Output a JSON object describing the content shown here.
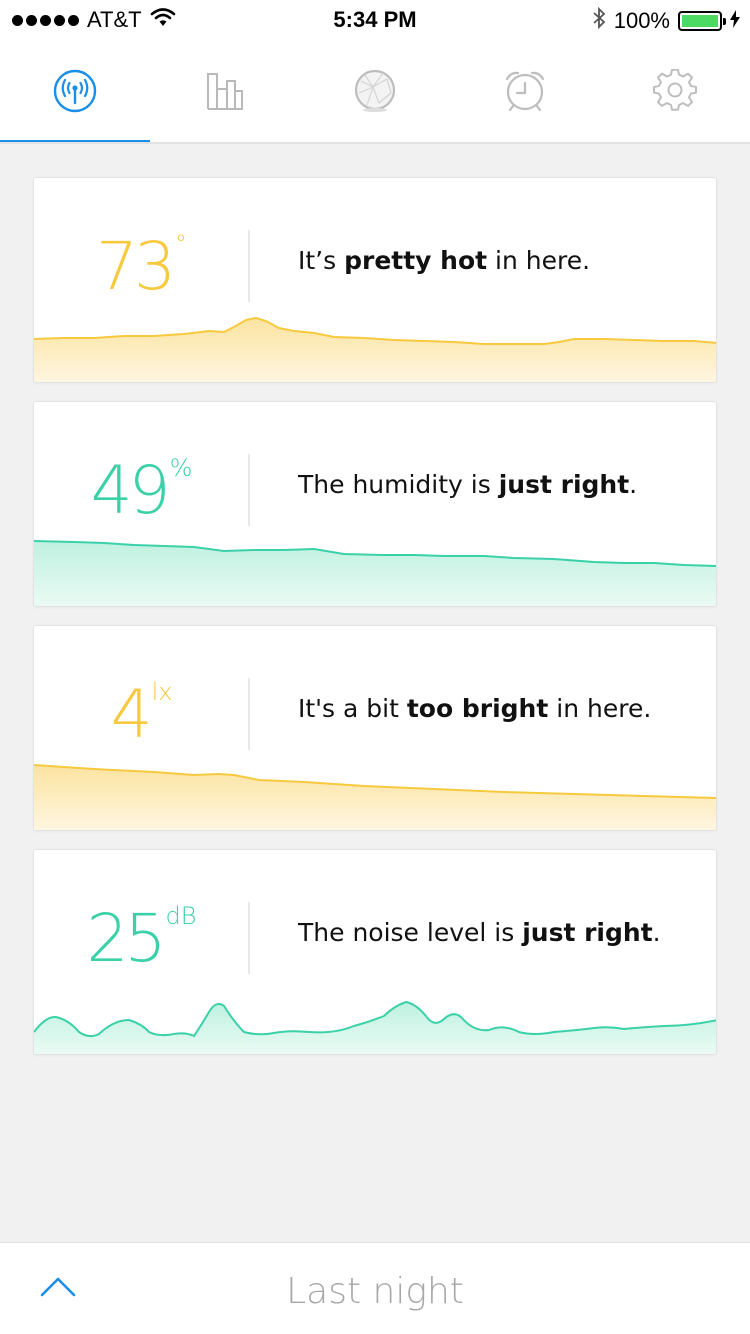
{
  "status_bar": {
    "carrier": "AT&T",
    "time": "5:34 PM",
    "battery": "100%"
  },
  "tabs": [
    {
      "icon": "broadcast-icon",
      "active": true
    },
    {
      "icon": "bar-chart-icon",
      "active": false
    },
    {
      "icon": "sleep-sphere-icon",
      "active": false
    },
    {
      "icon": "alarm-clock-icon",
      "active": false
    },
    {
      "icon": "gear-icon",
      "active": false
    }
  ],
  "cards": [
    {
      "metric": "temperature",
      "value": "73",
      "unit": "°",
      "color": "#f7c93e",
      "message": {
        "pre": "It’s ",
        "bold": "pretty hot",
        "post": " in here."
      }
    },
    {
      "metric": "humidity",
      "value": "49",
      "unit": "%",
      "color": "#3ad1a9",
      "message": {
        "pre": "The humidity is ",
        "bold": "just right",
        "post": "."
      }
    },
    {
      "metric": "light",
      "value": "4",
      "unit": "lx",
      "color": "#f7c93e",
      "message": {
        "pre": "It's a bit ",
        "bold": "too bright",
        "post": " in here."
      }
    },
    {
      "metric": "noise",
      "value": "25",
      "unit": "dB",
      "color": "#3ad1a9",
      "message": {
        "pre": "The noise level is ",
        "bold": "just right",
        "post": "."
      }
    }
  ],
  "bottom_bar": {
    "label": "Last night",
    "chevron_icon": "chevron-up-icon"
  },
  "colors": {
    "accent_blue": "#1a8ee8",
    "yellow": "#f7c93e",
    "teal": "#3ad1a9"
  }
}
